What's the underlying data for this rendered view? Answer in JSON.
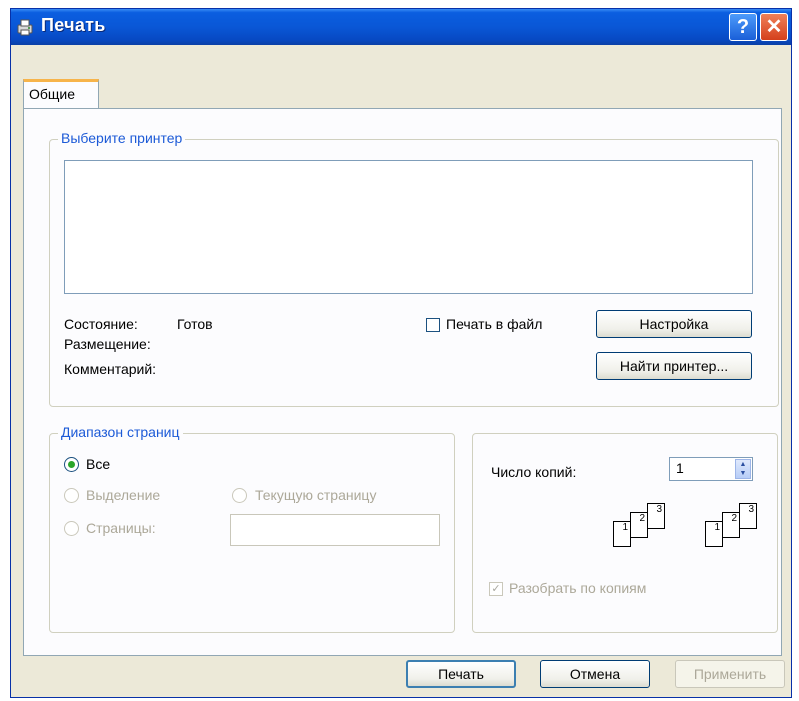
{
  "window": {
    "title": "Печать"
  },
  "tabs": [
    {
      "label": "Общие"
    }
  ],
  "printer_group": {
    "legend": "Выберите принтер",
    "status_label": "Состояние:",
    "status_value": "Готов",
    "location_label": "Размещение:",
    "comment_label": "Комментарий:",
    "print_to_file_label": "Печать в файл",
    "print_to_file_checked": false,
    "settings_button": "Настройка",
    "find_printer_button": "Найти принтер..."
  },
  "range_group": {
    "legend": "Диапазон страниц",
    "all_label": "Все",
    "selection_label": "Выделение",
    "current_page_label": "Текущую страницу",
    "pages_label": "Страницы:",
    "selected": "all"
  },
  "copies_group": {
    "copies_label": "Число копий:",
    "copies_value": "1",
    "collate_label": "Разобрать по копиям",
    "collate_checked": true,
    "page_numbers": [
      "1",
      "2",
      "3"
    ]
  },
  "footer": {
    "print_button": "Печать",
    "cancel_button": "Отмена",
    "apply_button": "Применить"
  },
  "colors": {
    "titlebar": "#0a57d6",
    "legend_text": "#1c5ad7",
    "dialog_face": "#ece9d8"
  },
  "icons": [
    "printer-icon",
    "help-icon",
    "close-icon",
    "spin-up-icon",
    "spin-down-icon",
    "collate-pages-icon"
  ]
}
